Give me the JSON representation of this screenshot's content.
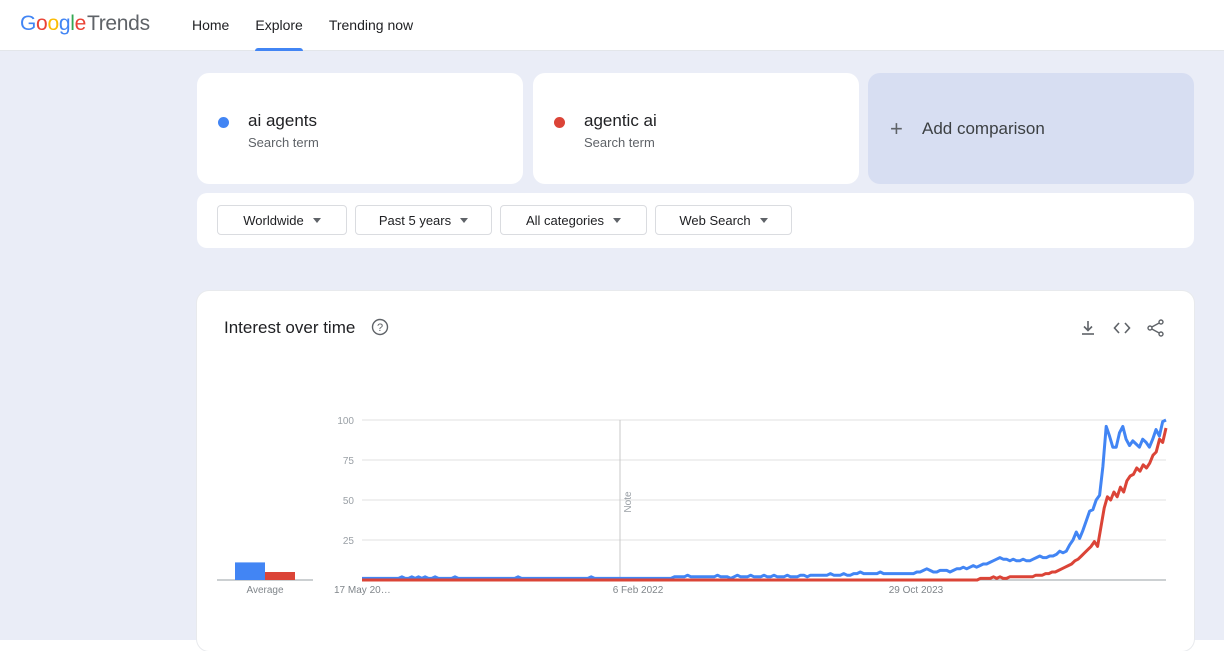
{
  "header": {
    "logo_letters": [
      "G",
      "o",
      "o",
      "g",
      "l",
      "e"
    ],
    "logo_brand": "Trends",
    "nav": [
      {
        "label": "Home",
        "active": false
      },
      {
        "label": "Explore",
        "active": true
      },
      {
        "label": "Trending now",
        "active": false
      }
    ]
  },
  "terms": [
    {
      "term": "ai agents",
      "subtitle": "Search term",
      "color": "#4285f4"
    },
    {
      "term": "agentic ai",
      "subtitle": "Search term",
      "color": "#db4437"
    }
  ],
  "add_comparison": {
    "icon": "plus-icon",
    "label": "Add comparison"
  },
  "filters": [
    {
      "label": "Worldwide"
    },
    {
      "label": "Past 5 years"
    },
    {
      "label": "All categories"
    },
    {
      "label": "Web Search"
    }
  ],
  "chart": {
    "title": "Interest over time",
    "help_icon": "help-circle-icon",
    "tools": [
      "download-icon",
      "embed-code-icon",
      "share-icon"
    ],
    "average_label": "Average",
    "note_label": "Note"
  },
  "chart_data": {
    "type": "line",
    "xlabel": "",
    "ylabel": "",
    "ylim": [
      0,
      100
    ],
    "yticks": [
      25,
      50,
      75,
      100
    ],
    "x_tick_labels": [
      "17 May 20…",
      "6 Feb 2022",
      "29 Oct 2023"
    ],
    "averages": [
      {
        "series": "ai agents",
        "value": 11,
        "color": "#4285f4"
      },
      {
        "series": "agentic ai",
        "value": 5,
        "color": "#db4437"
      }
    ],
    "series": [
      {
        "name": "ai agents",
        "color": "#4285f4",
        "values": [
          1,
          1,
          1,
          1,
          1,
          1,
          1,
          1,
          1,
          1,
          1,
          1,
          2,
          1,
          1,
          2,
          1,
          2,
          1,
          2,
          1,
          1,
          2,
          1,
          1,
          1,
          1,
          1,
          2,
          1,
          1,
          1,
          1,
          1,
          1,
          1,
          1,
          1,
          1,
          1,
          1,
          1,
          1,
          1,
          1,
          1,
          1,
          2,
          1,
          1,
          1,
          1,
          1,
          1,
          1,
          1,
          1,
          1,
          1,
          1,
          1,
          1,
          1,
          1,
          1,
          1,
          1,
          1,
          1,
          2,
          1,
          1,
          1,
          1,
          1,
          1,
          1,
          1,
          1,
          1,
          1,
          1,
          1,
          1,
          1,
          1,
          1,
          1,
          1,
          1,
          1,
          1,
          1,
          1,
          2,
          2,
          2,
          2,
          3,
          2,
          2,
          2,
          2,
          2,
          2,
          2,
          2,
          3,
          2,
          2,
          2,
          1,
          2,
          3,
          2,
          2,
          2,
          3,
          2,
          2,
          2,
          3,
          2,
          2,
          3,
          2,
          2,
          2,
          3,
          2,
          2,
          2,
          3,
          3,
          2,
          3,
          3,
          3,
          3,
          3,
          3,
          4,
          3,
          3,
          3,
          4,
          3,
          3,
          4,
          4,
          5,
          4,
          4,
          4,
          4,
          4,
          5,
          4,
          4,
          4,
          4,
          4,
          4,
          4,
          4,
          4,
          4,
          5,
          5,
          6,
          7,
          6,
          5,
          5,
          6,
          6,
          6,
          5,
          6,
          7,
          7,
          8,
          7,
          8,
          9,
          8,
          9,
          10,
          10,
          11,
          12,
          13,
          14,
          13,
          13,
          12,
          13,
          12,
          12,
          13,
          12,
          12,
          13,
          14,
          15,
          14,
          14,
          15,
          15,
          16,
          18,
          17,
          18,
          22,
          25,
          30,
          26,
          31,
          37,
          43,
          44,
          50,
          53,
          71,
          96,
          90,
          83,
          83,
          92,
          96,
          88,
          84,
          87,
          85,
          83,
          88,
          86,
          83,
          88,
          94,
          90,
          99,
          100
        ]
      },
      {
        "name": "agentic ai",
        "color": "#db4437",
        "values": [
          0,
          0,
          0,
          0,
          0,
          0,
          0,
          0,
          0,
          0,
          0,
          0,
          0,
          0,
          0,
          0,
          0,
          0,
          0,
          0,
          0,
          0,
          0,
          0,
          0,
          0,
          0,
          0,
          0,
          0,
          0,
          0,
          0,
          0,
          0,
          0,
          0,
          0,
          0,
          0,
          0,
          0,
          0,
          0,
          0,
          0,
          0,
          0,
          0,
          0,
          0,
          0,
          0,
          0,
          0,
          0,
          0,
          0,
          0,
          0,
          0,
          0,
          0,
          0,
          0,
          0,
          0,
          0,
          0,
          0,
          0,
          0,
          0,
          0,
          0,
          0,
          0,
          0,
          0,
          0,
          0,
          0,
          0,
          0,
          0,
          0,
          0,
          0,
          0,
          0,
          0,
          0,
          0,
          0,
          0,
          0,
          0,
          0,
          0,
          0,
          0,
          0,
          0,
          0,
          0,
          0,
          0,
          0,
          0,
          0,
          0,
          0,
          0,
          0,
          0,
          0,
          0,
          0,
          0,
          0,
          0,
          0,
          0,
          0,
          0,
          0,
          0,
          0,
          0,
          0,
          0,
          0,
          0,
          0,
          0,
          0,
          0,
          0,
          0,
          0,
          0,
          0,
          0,
          0,
          0,
          0,
          0,
          0,
          0,
          0,
          0,
          0,
          0,
          0,
          0,
          0,
          0,
          0,
          0,
          0,
          0,
          0,
          0,
          0,
          0,
          0,
          0,
          0,
          0,
          0,
          0,
          0,
          0,
          0,
          0,
          0,
          0,
          0,
          0,
          0,
          0,
          0,
          0,
          0,
          0,
          0,
          0,
          0,
          0,
          0,
          1,
          1,
          1,
          1,
          2,
          1,
          2,
          1,
          1,
          2,
          2,
          2,
          2,
          2,
          2,
          2,
          2,
          3,
          3,
          3,
          4,
          4,
          5,
          5,
          6,
          7,
          8,
          9,
          10,
          12,
          13,
          15,
          17,
          19,
          21,
          24,
          21,
          33,
          45,
          52,
          50,
          55,
          52,
          58,
          55,
          62,
          65,
          66,
          70,
          68,
          72,
          70,
          73,
          78,
          80,
          88,
          86,
          95
        ]
      }
    ]
  }
}
